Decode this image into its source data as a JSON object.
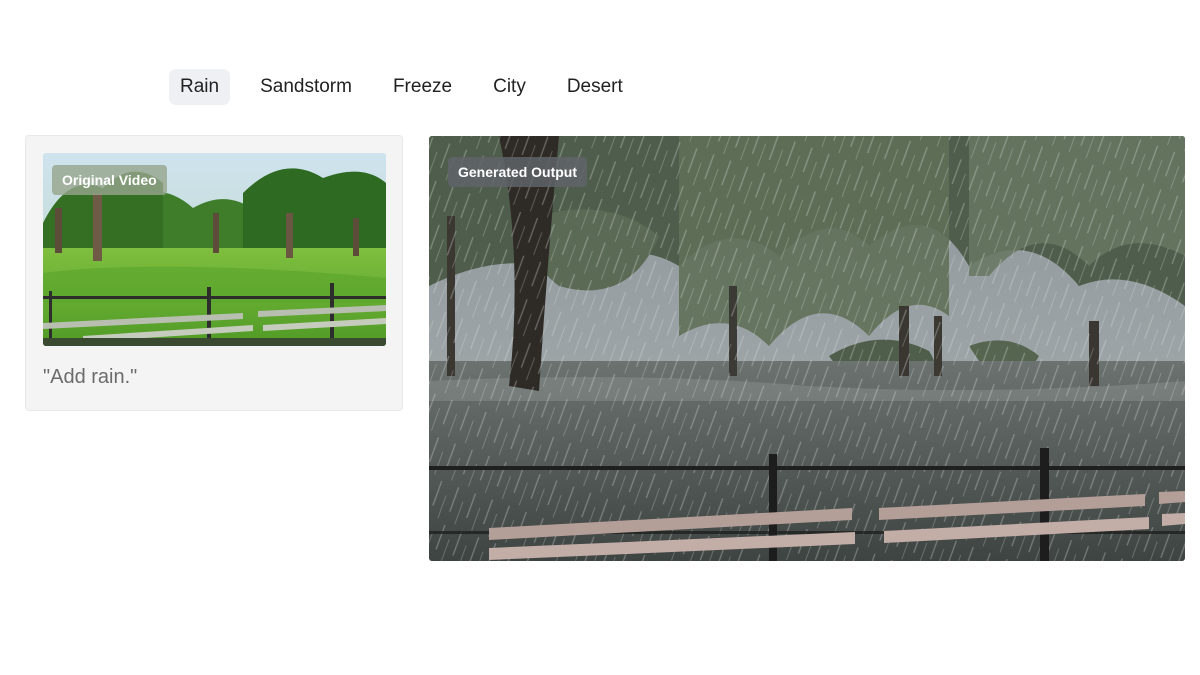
{
  "tabs": [
    {
      "label": "Rain",
      "active": true
    },
    {
      "label": "Sandstorm",
      "active": false
    },
    {
      "label": "Freeze",
      "active": false
    },
    {
      "label": "City",
      "active": false
    },
    {
      "label": "Desert",
      "active": false
    }
  ],
  "source": {
    "badge": "Original Video",
    "prompt": "\"Add rain.\""
  },
  "output": {
    "badge": "Generated Output"
  },
  "colors": {
    "active_tab_bg": "#eef0f3",
    "card_bg": "#f4f4f4",
    "prompt_text": "#6b6b6b"
  }
}
